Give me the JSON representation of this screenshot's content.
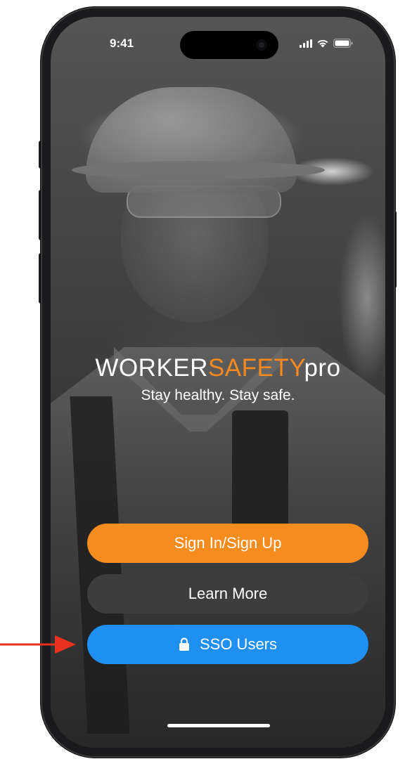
{
  "status_bar": {
    "time": "9:41"
  },
  "brand": {
    "logo_part1": "WORKER",
    "logo_part2": "SAFETY",
    "logo_part3": "pro",
    "tagline": "Stay healthy. Stay safe."
  },
  "buttons": {
    "sign_in": "Sign In/Sign Up",
    "learn_more": "Learn More",
    "sso": "SSO Users"
  },
  "colors": {
    "accent_orange": "#f68b1e",
    "sso_blue": "#1f8ff2",
    "secondary_gray": "#3d3d3d",
    "annotation_red": "#e8311f"
  },
  "icons": [
    "signal-icon",
    "wifi-icon",
    "battery-icon",
    "lock-icon",
    "arrow-icon"
  ]
}
